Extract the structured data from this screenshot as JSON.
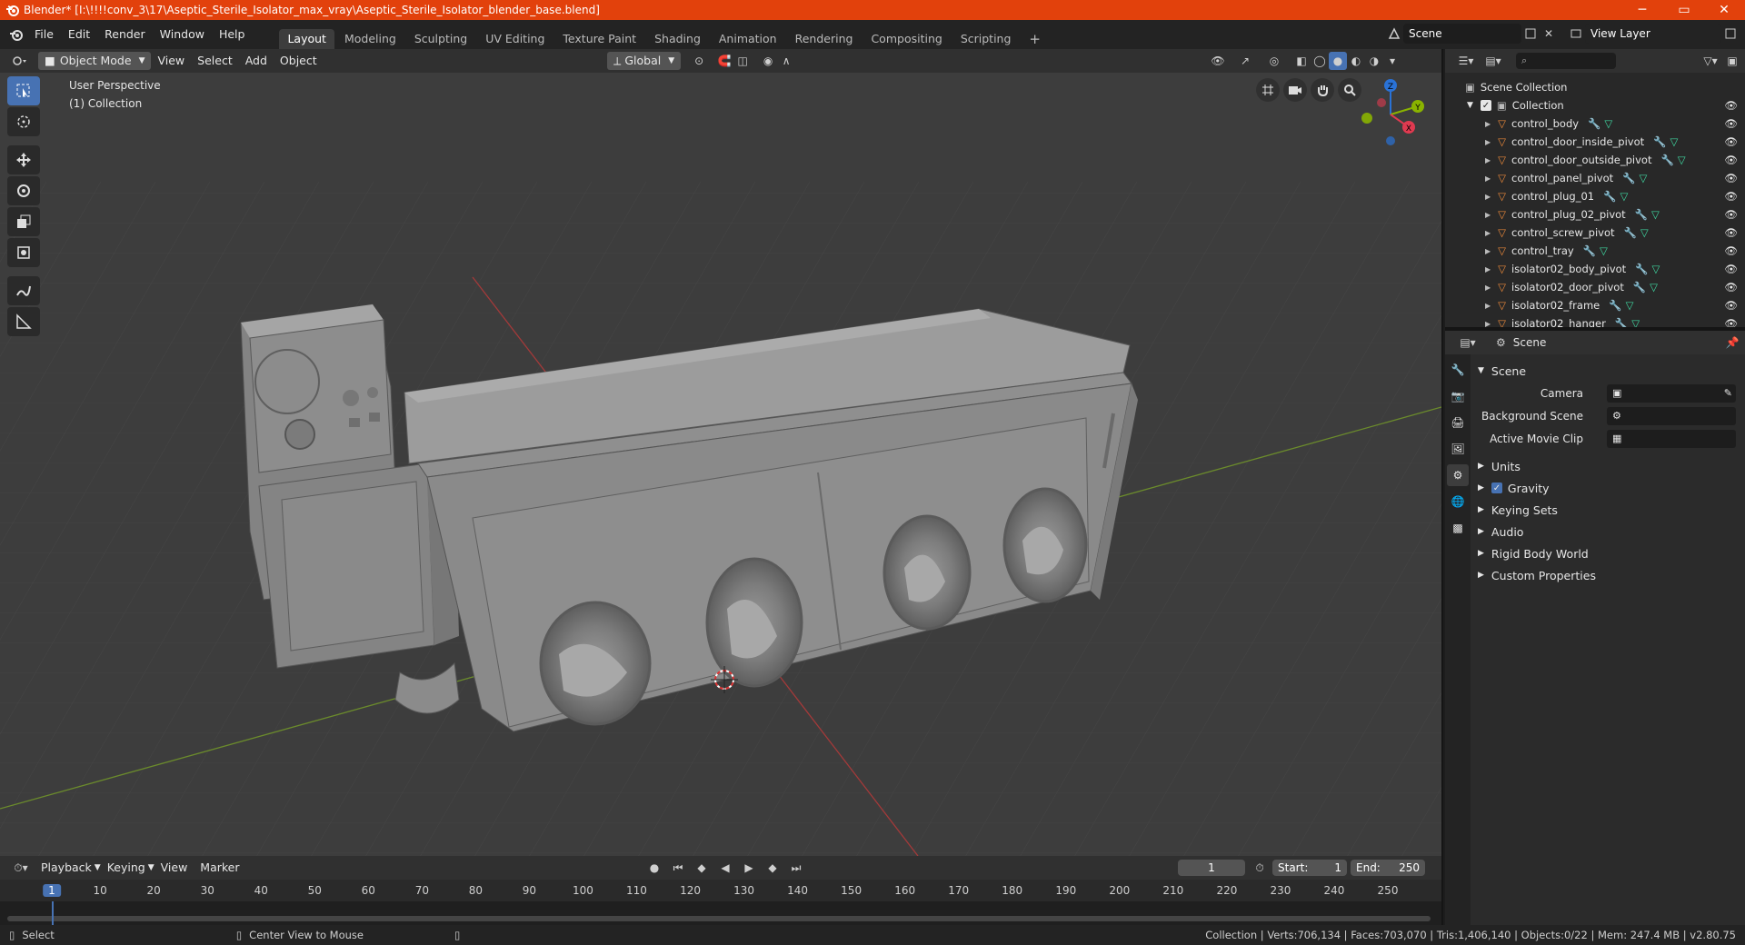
{
  "titlebar": {
    "title": "Blender* [I:\\!!!!conv_3\\17\\Aseptic_Sterile_Isolator_max_vray\\Aseptic_Sterile_Isolator_blender_base.blend]",
    "minimize": "─",
    "maximize": "▭",
    "close": "✕"
  },
  "menu": {
    "file": "File",
    "edit": "Edit",
    "render": "Render",
    "window": "Window",
    "help": "Help"
  },
  "workspaces": [
    {
      "label": "Layout",
      "active": true
    },
    {
      "label": "Modeling"
    },
    {
      "label": "Sculpting"
    },
    {
      "label": "UV Editing"
    },
    {
      "label": "Texture Paint"
    },
    {
      "label": "Shading"
    },
    {
      "label": "Animation"
    },
    {
      "label": "Rendering"
    },
    {
      "label": "Compositing"
    },
    {
      "label": "Scripting"
    }
  ],
  "add_workspace": "+",
  "scene_selector": {
    "value": "Scene"
  },
  "view_layer": {
    "value": "View Layer"
  },
  "viewport_header": {
    "mode": "Object Mode",
    "view": "View",
    "select": "Select",
    "add": "Add",
    "object": "Object",
    "orientation": "Global"
  },
  "viewport_info": {
    "perspective": "User Perspective",
    "collection": "(1) Collection"
  },
  "gizmo": {
    "z": "Z",
    "y": "Y",
    "x": "X"
  },
  "outliner": {
    "scene_collection": "Scene Collection",
    "collection": "Collection",
    "items": [
      "control_body",
      "control_door_inside_pivot",
      "control_door_outside_pivot",
      "control_panel_pivot",
      "control_plug_01",
      "control_plug_02_pivot",
      "control_screw_pivot",
      "control_tray",
      "isolator02_body_pivot",
      "isolator02_door_pivot",
      "isolator02_frame",
      "isolator02_hanger"
    ]
  },
  "properties": {
    "context": "Scene",
    "section": "Scene",
    "camera_label": "Camera",
    "background_scene_label": "Background Scene",
    "active_movie_clip_label": "Active Movie Clip",
    "subsections": [
      "Units",
      "Gravity",
      "Keying Sets",
      "Audio",
      "Rigid Body World",
      "Custom Properties"
    ]
  },
  "timeline": {
    "playback": "Playback",
    "keying": "Keying",
    "view": "View",
    "marker": "Marker",
    "current_frame": "1",
    "start_label": "Start:",
    "start": "1",
    "end_label": "End:",
    "end": "250",
    "ticks": [
      "1",
      "10",
      "20",
      "30",
      "40",
      "50",
      "60",
      "70",
      "80",
      "90",
      "100",
      "110",
      "120",
      "130",
      "140",
      "150",
      "160",
      "170",
      "180",
      "190",
      "200",
      "210",
      "220",
      "230",
      "240",
      "250"
    ]
  },
  "statusbar": {
    "select": "Select",
    "center_view": "Center View to Mouse",
    "stats": "Collection | Verts:706,134 | Faces:703,070 | Tris:1,406,140 | Objects:0/22 | Mem: 247.4 MB | v2.80.75"
  },
  "colors": {
    "accent": "#4772b3",
    "titlebar": "#e2410c",
    "mesh_icon": "#e8873a",
    "modifier_icon": "#6fa8dc",
    "data_icon": "#3fd6a0"
  }
}
